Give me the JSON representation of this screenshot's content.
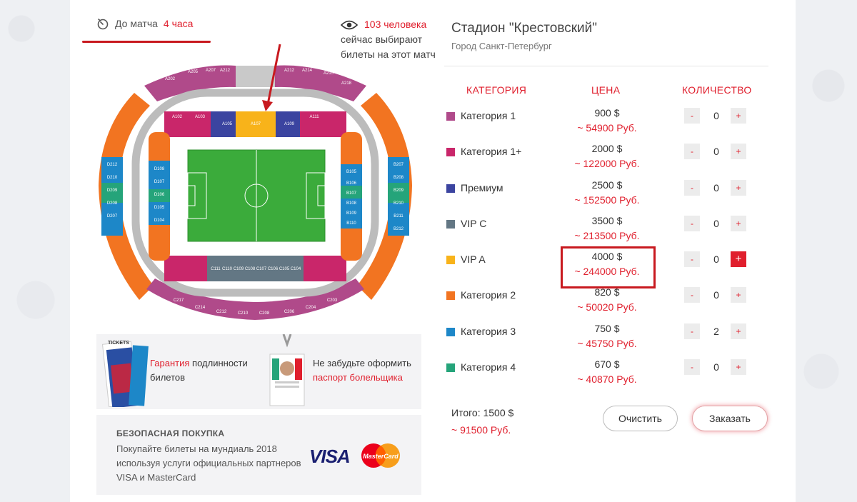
{
  "header": {
    "timer_label": "До матча",
    "timer_value": "4 часа",
    "viewers_count": "103 человека",
    "viewers_line2": "сейчас выбирают",
    "viewers_line3": "билеты на этот матч"
  },
  "venue": {
    "name": "Стадион \"Крестовский\"",
    "city": "Город Санкт-Петербург"
  },
  "table": {
    "col_category": "КАТЕГОРИЯ",
    "col_price": "ЦЕНА",
    "col_quantity": "КОЛИЧЕСТВО",
    "rows": [
      {
        "name": "Категория 1",
        "usd": "900 $",
        "rub": "~ 54900 Руб.",
        "qty": "0",
        "color": "#b04a8a"
      },
      {
        "name": "Категория 1+",
        "usd": "2000 $",
        "rub": "~ 122000 Руб.",
        "qty": "0",
        "color": "#c9266a"
      },
      {
        "name": "Премиум",
        "usd": "2500 $",
        "rub": "~ 152500 Руб.",
        "qty": "0",
        "color": "#3b44a0"
      },
      {
        "name": "VIP C",
        "usd": "3500 $",
        "rub": "~ 213500 Руб.",
        "qty": "0",
        "color": "#637784"
      },
      {
        "name": "VIP A",
        "usd": "4000 $",
        "rub": "~ 244000 Руб.",
        "qty": "0",
        "color": "#f8b31a"
      },
      {
        "name": "Категория 2",
        "usd": "820 $",
        "rub": "~ 50020 Руб.",
        "qty": "0",
        "color": "#f27421"
      },
      {
        "name": "Категория 3",
        "usd": "750 $",
        "rub": "~ 45750 Руб.",
        "qty": "2",
        "color": "#1d87c8"
      },
      {
        "name": "Категория 4",
        "usd": "670 $",
        "rub": "~ 40870 Руб.",
        "qty": "0",
        "color": "#25a47a"
      }
    ],
    "minus": "-",
    "plus": "+"
  },
  "totals": {
    "usd": "Итого: 1500 $",
    "rub": "~ 91500 Руб."
  },
  "buttons": {
    "clear": "Очистить",
    "order": "Заказать"
  },
  "banners": {
    "guarantee_red": "Гарантия",
    "guarantee_rest": " подлинности",
    "guarantee_line2": "билетов",
    "passport_line1": "Не забудьте оформить",
    "passport_line2": "паспорт болельщика",
    "tickets_word": "TICKETS",
    "secure_title": "БЕЗОПАСНАЯ ПОКУПКА",
    "secure_line1": "Покупайте билеты на мундиаль 2018",
    "secure_line2": "используя услуги официальных партнеров",
    "secure_line3": "VISA и MasterCard",
    "visa": "VISA",
    "mastercard": "MasterCard"
  },
  "stadium_map": {
    "top_a": [
      "A201",
      "A202",
      "A204",
      "A205",
      "A206",
      "A207",
      "A212",
      "A213",
      "A214",
      "A215",
      "A216",
      "A218"
    ],
    "inner_a": [
      "A101",
      "A102",
      "A103",
      "A104",
      "A105",
      "A106",
      "A107",
      "A108",
      "A109",
      "A110",
      "A111",
      "A112"
    ],
    "left_d": [
      "D212",
      "D211",
      "D210",
      "D209",
      "D208",
      "D207"
    ],
    "right_b": [
      "B207",
      "B208",
      "B209",
      "B210",
      "B211",
      "B212"
    ],
    "inner_b": [
      "B105",
      "B106",
      "B107",
      "B108",
      "B109",
      "B110"
    ],
    "inner_d": [
      "D108",
      "D107",
      "D106",
      "D105",
      "D104"
    ],
    "inner_c": [
      "C111",
      "C110",
      "C109",
      "C108",
      "C107",
      "C106",
      "C105",
      "C104"
    ],
    "bottom_c": [
      "C217",
      "C215",
      "C214",
      "C213",
      "C212",
      "C211",
      "C210",
      "C209",
      "C208",
      "C207",
      "C206",
      "C205",
      "C204",
      "C203"
    ]
  }
}
